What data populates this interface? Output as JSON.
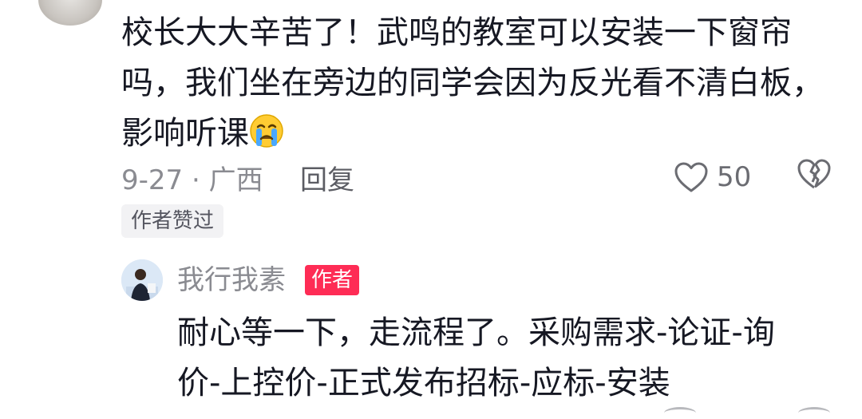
{
  "comment": {
    "text": "校长大大辛苦了！武鸣的教室可以安装一下窗帘吗，我们坐在旁边的同学会因为反光看不清白板，影响听课",
    "emoji": "crying-face-emoji",
    "date_location": "9-27 · 广西",
    "reply_label": "回复",
    "like_count": "50",
    "author_liked_label": "作者赞过"
  },
  "reply": {
    "username": "我行我素",
    "author_badge": "作者",
    "text": "耐心等一下，走流程了。采购需求-论证-询价-上控价-正式发布招标-应标-安装"
  },
  "colors": {
    "badge": "#fe2c55",
    "secondary_text": "#8a8b91",
    "primary_text": "#161823"
  },
  "icons": {
    "like": "heart-outline-icon",
    "dislike": "broken-heart-icon"
  }
}
